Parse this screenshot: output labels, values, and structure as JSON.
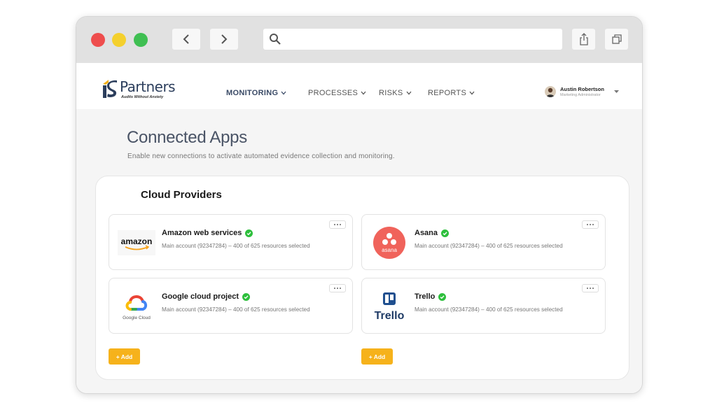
{
  "browser": {
    "url": ""
  },
  "header": {
    "logo_text": "Partners",
    "logo_tagline": "Audits Without Anxiety",
    "menu": [
      {
        "label": "MONITORING",
        "active": true
      },
      {
        "label": "PROCESSES",
        "active": false
      },
      {
        "label": "RISKS",
        "active": false
      },
      {
        "label": "REPORTS",
        "active": false
      }
    ],
    "user": {
      "name": "Austin Robertson",
      "role": "Marketing Administrator"
    }
  },
  "page": {
    "title": "Connected Apps",
    "subtitle": "Enable new connections to activate automated evidence collection and monitoring."
  },
  "panel": {
    "title": "Cloud Providers",
    "cards": [
      {
        "name": "Amazon web services",
        "logo": "amazon",
        "logo_text": "amazon",
        "description": "Main account (92347284) – 400 of 625 resources selected",
        "connected": true
      },
      {
        "name": "Asana",
        "logo": "asana",
        "logo_text": "asana",
        "description": "Main account (92347284) – 400 of 625 resources selected",
        "connected": true
      },
      {
        "name": "Google cloud project",
        "logo": "google-cloud",
        "logo_text": "Google Cloud",
        "description": "Main account (92347284) – 400 of 625 resources selected",
        "connected": true
      },
      {
        "name": "Trello",
        "logo": "trello",
        "logo_text": "Trello",
        "description": "Main account (92347284) – 400 of 625 resources selected",
        "connected": true
      }
    ],
    "add_label": "+ Add"
  },
  "colors": {
    "accent": "#f6b21b",
    "check_green": "#2dbf3c",
    "title_color": "#4a5466"
  }
}
